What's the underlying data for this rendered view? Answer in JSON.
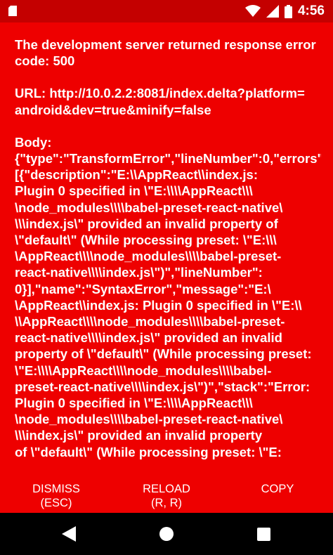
{
  "status_bar": {
    "time": "4:56",
    "icons": [
      "sd-card-icon",
      "wifi-icon",
      "cell-signal-icon",
      "battery-icon"
    ],
    "background": "#c40000"
  },
  "error": {
    "title_lines": [
      "The development server returned response error",
      "code: 500"
    ],
    "url_lines": [
      "URL: http://10.0.2.2:8081/index.delta?platform=",
      "android&dev=true&minify=false"
    ],
    "body_label": "Body:",
    "body_lines": [
      "{\"type\":\"TransformError\",\"lineNumber\":0,\"errors\":",
      "[{\"description\":\"E:\\\\AppReact\\\\index.js:",
      "Plugin 0 specified in \\\"E:\\\\\\\\AppReact\\\\\\",
      "\\node_modules\\\\\\\\babel-preset-react-native\\",
      "\\\\\\index.js\\\" provided an invalid property of",
      "\\\"default\\\" (While processing preset: \\\"E:\\\\\\",
      "\\AppReact\\\\\\\\node_modules\\\\\\\\babel-preset-",
      "react-native\\\\\\\\index.js\\\")\",\"lineNumber\":",
      "0}],\"name\":\"SyntaxError\",\"message\":\"E:\\",
      "\\AppReact\\\\index.js: Plugin 0 specified in \\\"E:\\\\",
      "\\\\AppReact\\\\\\\\node_modules\\\\\\\\babel-preset-",
      "react-native\\\\\\\\index.js\\\" provided an invalid",
      "property of \\\"default\\\" (While processing preset:",
      "\\\"E:\\\\\\\\AppReact\\\\\\\\node_modules\\\\\\\\babel-",
      "preset-react-native\\\\\\\\index.js\\\")\",\"stack\":\"Error:",
      "Plugin 0 specified in \\\"E:\\\\\\\\AppReact\\\\\\",
      "\\node_modules\\\\\\\\babel-preset-react-native\\",
      "\\\\\\index.js\\\" provided an invalid property",
      "of \\\"default\\\" (While processing preset: \\\"E:"
    ],
    "background": "#ee0000"
  },
  "actions": {
    "dismiss": {
      "label": "DISMISS",
      "sub": "(ESC)"
    },
    "reload": {
      "label": "RELOAD",
      "sub": "(R, R)"
    },
    "copy": {
      "label": "COPY"
    }
  },
  "nav_bar": {
    "icons": [
      "back-icon",
      "home-icon",
      "recents-icon"
    ]
  }
}
